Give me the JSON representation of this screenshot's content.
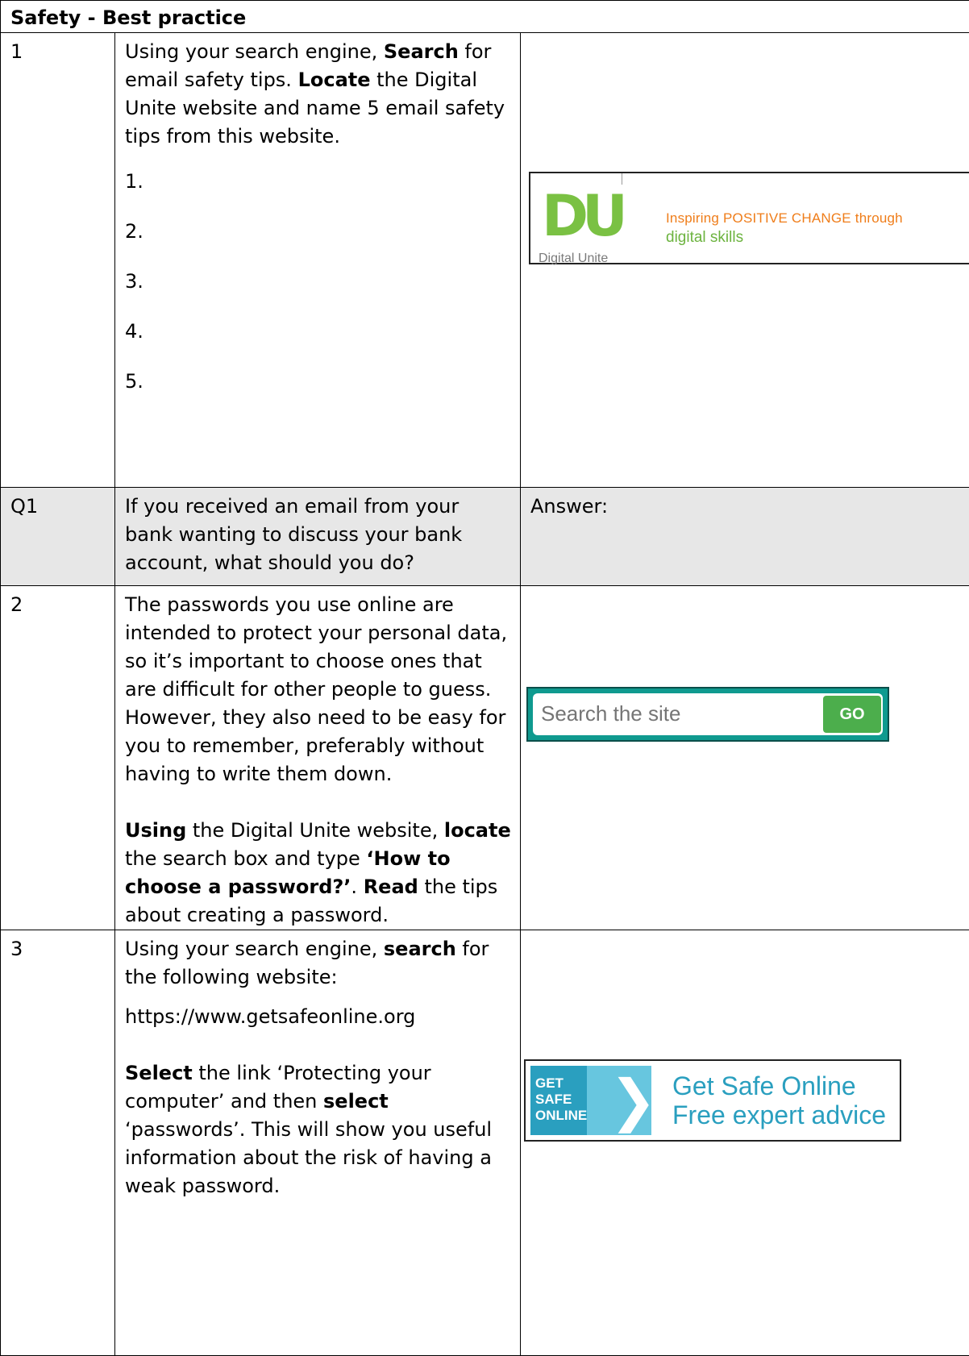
{
  "header": "Safety - Best practice",
  "row1": {
    "num": "1",
    "p1": "Using your search engine, ",
    "b1": "Search",
    "p2": " for email safety tips. ",
    "b2": "Locate",
    "p3": " the Digital Unite website and name 5 email safety tips from this website.",
    "tips": [
      "1.",
      "2.",
      "3.",
      "4.",
      "5."
    ]
  },
  "du_logo": {
    "mark": "DU",
    "caption": "Digital Unite",
    "tagline1": "Inspiring POSITIVE CHANGE through",
    "tagline2": "digital skills"
  },
  "q1": {
    "num": "Q1",
    "question": "If you received an email from your bank wanting to discuss your bank account, what should you do?",
    "answer_label": "Answer:"
  },
  "row2": {
    "num": "2",
    "para1": "The passwords you use online are intended to protect your personal data, so it’s important to choose ones that are difficult for other people to guess. However, they also need to be easy for you to remember, preferably without having to write them down.",
    "b1": "Using",
    "p1": " the Digital Unite website, ",
    "b2": "locate",
    "p2": " the search box and type ",
    "b3": "‘How to choose a password?’",
    "p3": ". ",
    "b4": "Read",
    "p4": " the tips about creating a password."
  },
  "search_widget": {
    "placeholder": "Search the site",
    "button": "GO"
  },
  "row3": {
    "num": "3",
    "p1": "Using your search engine, ",
    "b1": "search",
    "p2": " for the following website:",
    "url": "https://www.getsafeonline.org",
    "b2": "Select",
    "p3": " the link ‘Protecting your computer’ and then ",
    "b3": "select",
    "p4": " ‘passwords’. This will show you useful information about the risk of having a weak password."
  },
  "gso_logo": {
    "word1": "GET",
    "word2": "SAFE",
    "word3": "ONLINE",
    "title": "Get Safe Online",
    "subtitle": "Free expert advice"
  }
}
